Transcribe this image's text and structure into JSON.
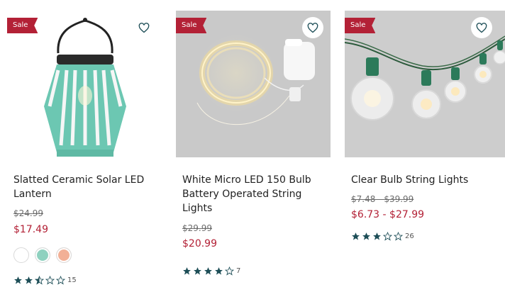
{
  "products": [
    {
      "badge": "Sale",
      "title": "Slatted Ceramic Solar LED Lantern",
      "original_price": "$24.99",
      "sale_price": "$17.49",
      "swatches": [
        "#ffffff",
        "#8ed1bf",
        "#f2b096"
      ],
      "rating": 2.5,
      "review_count": "15"
    },
    {
      "badge": "Sale",
      "title": "White Micro LED 150 Bulb Battery Operated String Lights",
      "original_price": "$29.99",
      "sale_price": "$20.99",
      "rating": 4,
      "review_count": "7"
    },
    {
      "badge": "Sale",
      "title": "Clear Bulb String Lights",
      "original_price": "$7.48 - $39.99",
      "sale_price": "$6.73 - $27.99",
      "rating": 3,
      "review_count": "26"
    }
  ],
  "colors": {
    "sale_red": "#b32136",
    "star_teal": "#1d4e57",
    "lantern_mint": "#6cc7b2",
    "string_green": "#2c7a5a"
  },
  "icons": {
    "favorite": "heart-outline-icon",
    "star": "star-icon"
  }
}
